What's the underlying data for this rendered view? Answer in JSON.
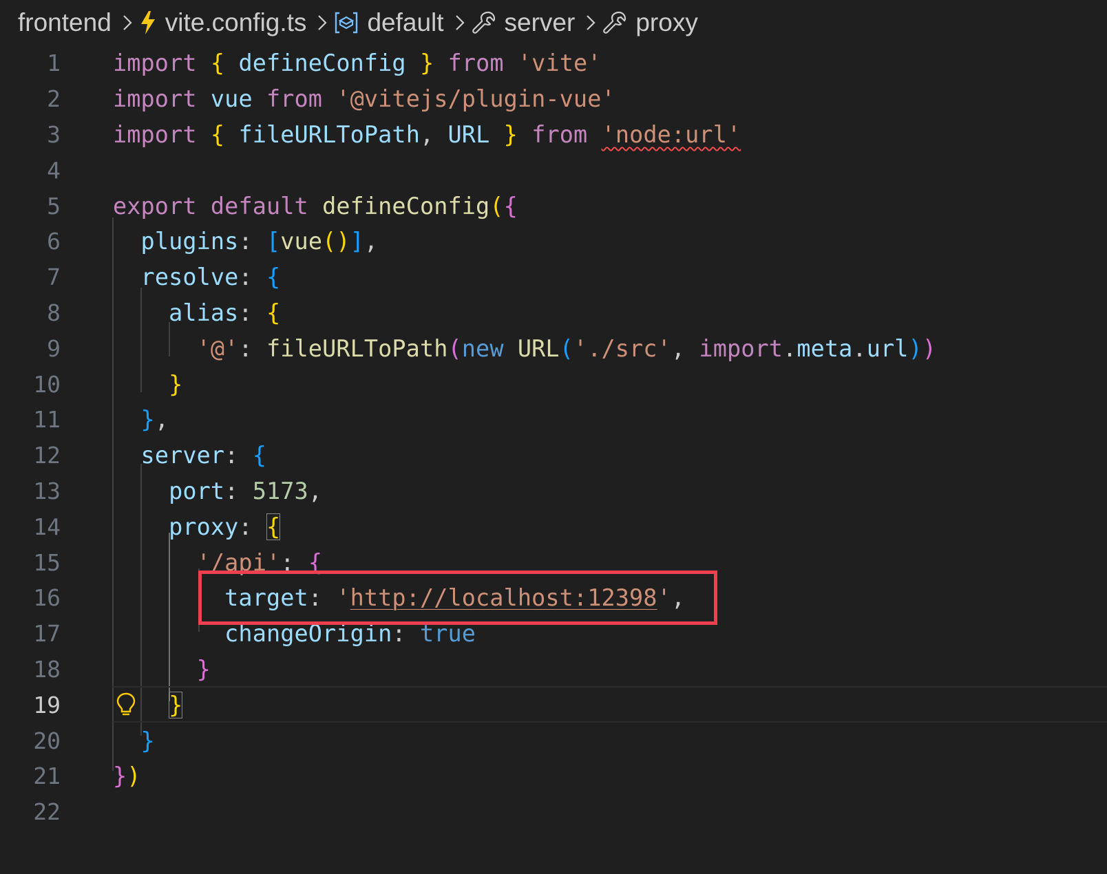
{
  "breadcrumb": [
    {
      "label": "frontend",
      "icon": null
    },
    {
      "label": "vite.config.ts",
      "icon": "lightning-icon"
    },
    {
      "label": "default",
      "icon": "module-icon"
    },
    {
      "label": "server",
      "icon": "wrench-icon"
    },
    {
      "label": "proxy",
      "icon": "wrench-icon"
    }
  ],
  "editor": {
    "line_numbers": [
      "1",
      "2",
      "3",
      "4",
      "5",
      "6",
      "7",
      "8",
      "9",
      "10",
      "11",
      "12",
      "13",
      "14",
      "15",
      "16",
      "17",
      "18",
      "19",
      "20",
      "21",
      "22"
    ],
    "active_line": "19",
    "colors": {
      "highlight_box": "#ef4050",
      "squiggle": "#f14c4c"
    },
    "l1": {
      "import": "import",
      "ob": "{",
      "name": "defineConfig",
      "cb": "}",
      "from": "from",
      "str": "'vite'"
    },
    "l2": {
      "import": "import",
      "name": "vue",
      "from": "from",
      "str": "'@vitejs/plugin-vue'"
    },
    "l3": {
      "import": "import",
      "ob": "{",
      "name1": "fileURLToPath",
      "comma": ",",
      "name2": "URL",
      "cb": "}",
      "from": "from",
      "str": "'node:url'"
    },
    "l5": {
      "export": "export",
      "default": "default",
      "fn": "defineConfig",
      "op": "(",
      "ob": "{"
    },
    "l6": {
      "key": "plugins",
      "colon": ":",
      "ob": "[",
      "fn": "vue",
      "call": "()",
      "cb": "]",
      "comma": ","
    },
    "l7": {
      "key": "resolve",
      "colon": ":",
      "ob": "{"
    },
    "l8": {
      "key": "alias",
      "colon": ":",
      "ob": "{"
    },
    "l9": {
      "key": "'@'",
      "colon": ":",
      "fn": "fileURLToPath",
      "op": "(",
      "new": "new",
      "cls": "URL",
      "op2": "(",
      "str": "'./src'",
      "comma": ",",
      "imp": "import",
      "dot1": ".",
      "meta": "meta",
      "dot2": ".",
      "url": "url",
      "cp2": ")",
      "cp": ")"
    },
    "l10": {
      "cb": "}"
    },
    "l11": {
      "cb": "}",
      "comma": ","
    },
    "l12": {
      "key": "server",
      "colon": ":",
      "ob": "{"
    },
    "l13": {
      "key": "port",
      "colon": ":",
      "num": "5173",
      "comma": ","
    },
    "l14": {
      "key": "proxy",
      "colon": ":",
      "ob": "{"
    },
    "l15": {
      "key": "'/api'",
      "colon": ":",
      "ob": "{"
    },
    "l16": {
      "key": "target",
      "colon": ":",
      "q1": "'",
      "url": "http://localhost:12398",
      "q2": "'",
      "comma": ","
    },
    "l17": {
      "key": "changeOrigin",
      "colon": ":",
      "val": "true"
    },
    "l18": {
      "cb": "}"
    },
    "l19": {
      "cb": "}"
    },
    "l20": {
      "cb": "}"
    },
    "l21": {
      "cb": "}",
      "cp": ")"
    }
  }
}
